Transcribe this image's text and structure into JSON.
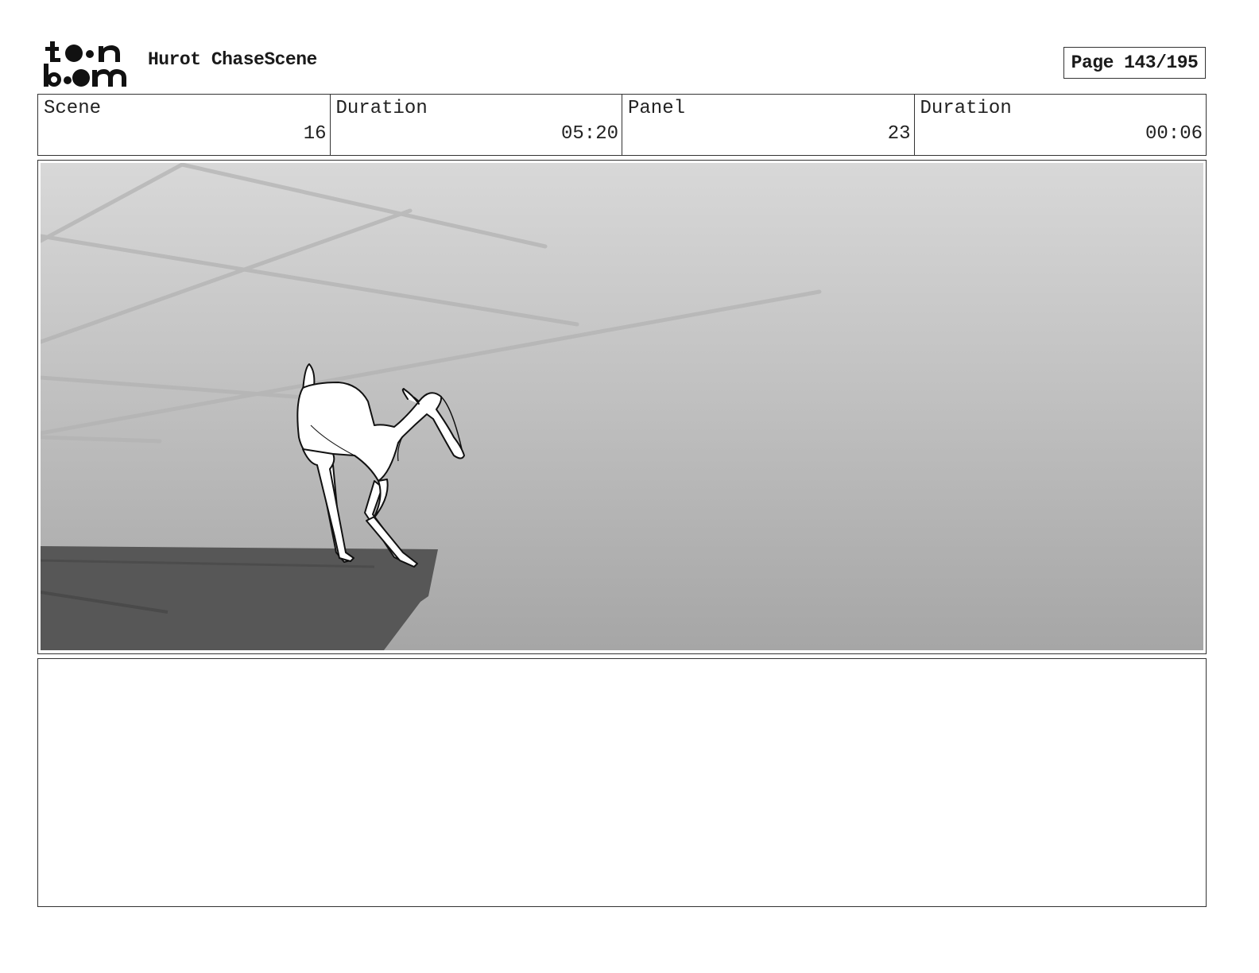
{
  "header": {
    "logo_icon": "toon-boom-logo-icon",
    "project_title": "Hurot ChaseScene",
    "page_label": "Page 143/195"
  },
  "info": {
    "scene_label": "Scene",
    "scene_value": "16",
    "scene_duration_label": "Duration",
    "scene_duration_value": "05:20",
    "panel_label": "Panel",
    "panel_value": "23",
    "panel_duration_label": "Duration",
    "panel_duration_value": "00:06"
  },
  "panel": {
    "image_icon": "deer-on-cliff-sketch-icon",
    "colors": {
      "sky_top": "#d8d8d8",
      "sky_bottom": "#a6a6a6",
      "cliff": "#575757",
      "deer": "#ffffff"
    }
  },
  "notes": {
    "text": ""
  }
}
